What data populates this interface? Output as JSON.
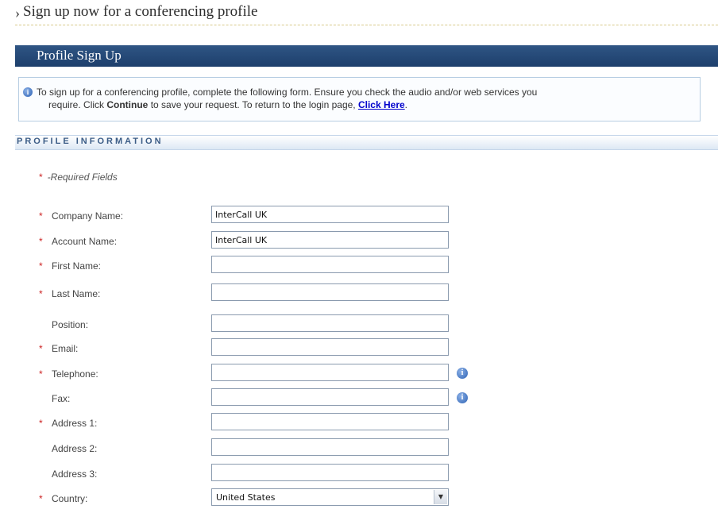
{
  "page_header": {
    "arrow": "›",
    "title": "Sign up now for a conferencing profile"
  },
  "panel": {
    "title": "Profile Sign Up"
  },
  "info": {
    "icon": "info-icon",
    "line1": "To sign up for a conferencing profile, complete the following form. Ensure you check the audio and/or web services you",
    "line2_pre": "require. Click ",
    "line2_bold": "Continue",
    "line2_mid": " to save your request. To return to the login page, ",
    "link": "Click Here",
    "line2_end": "."
  },
  "section": {
    "title": "PROFILE INFORMATION"
  },
  "required_note": {
    "star": "*",
    "text": "-Required Fields"
  },
  "fields": [
    {
      "label": "Company Name:",
      "required": "*",
      "value": "InterCall UK"
    },
    {
      "label": "Account Name:",
      "required": "*",
      "value": "InterCall UK"
    },
    {
      "label": "First Name:",
      "required": "*",
      "value": ""
    },
    {
      "label": "Last Name:",
      "required": "*",
      "value": ""
    },
    {
      "label": "Position:",
      "required": "",
      "value": ""
    },
    {
      "label": "Email:",
      "required": "*",
      "value": ""
    },
    {
      "label": "Telephone:",
      "required": "*",
      "value": "",
      "info_icon": "info-icon"
    },
    {
      "label": "Fax:",
      "required": "",
      "value": "",
      "info_icon": "info-icon"
    },
    {
      "label": "Address 1:",
      "required": "*",
      "value": ""
    },
    {
      "label": "Address 2:",
      "required": "",
      "value": ""
    },
    {
      "label": "Address 3:",
      "required": "",
      "value": ""
    },
    {
      "label": "Country:",
      "required": "*",
      "value": "United States",
      "type": "select"
    }
  ],
  "colors": {
    "header_bar": "#1d3f6c",
    "required": "#cc2222",
    "link": "#0000cc",
    "section_text": "#3b5c86"
  }
}
